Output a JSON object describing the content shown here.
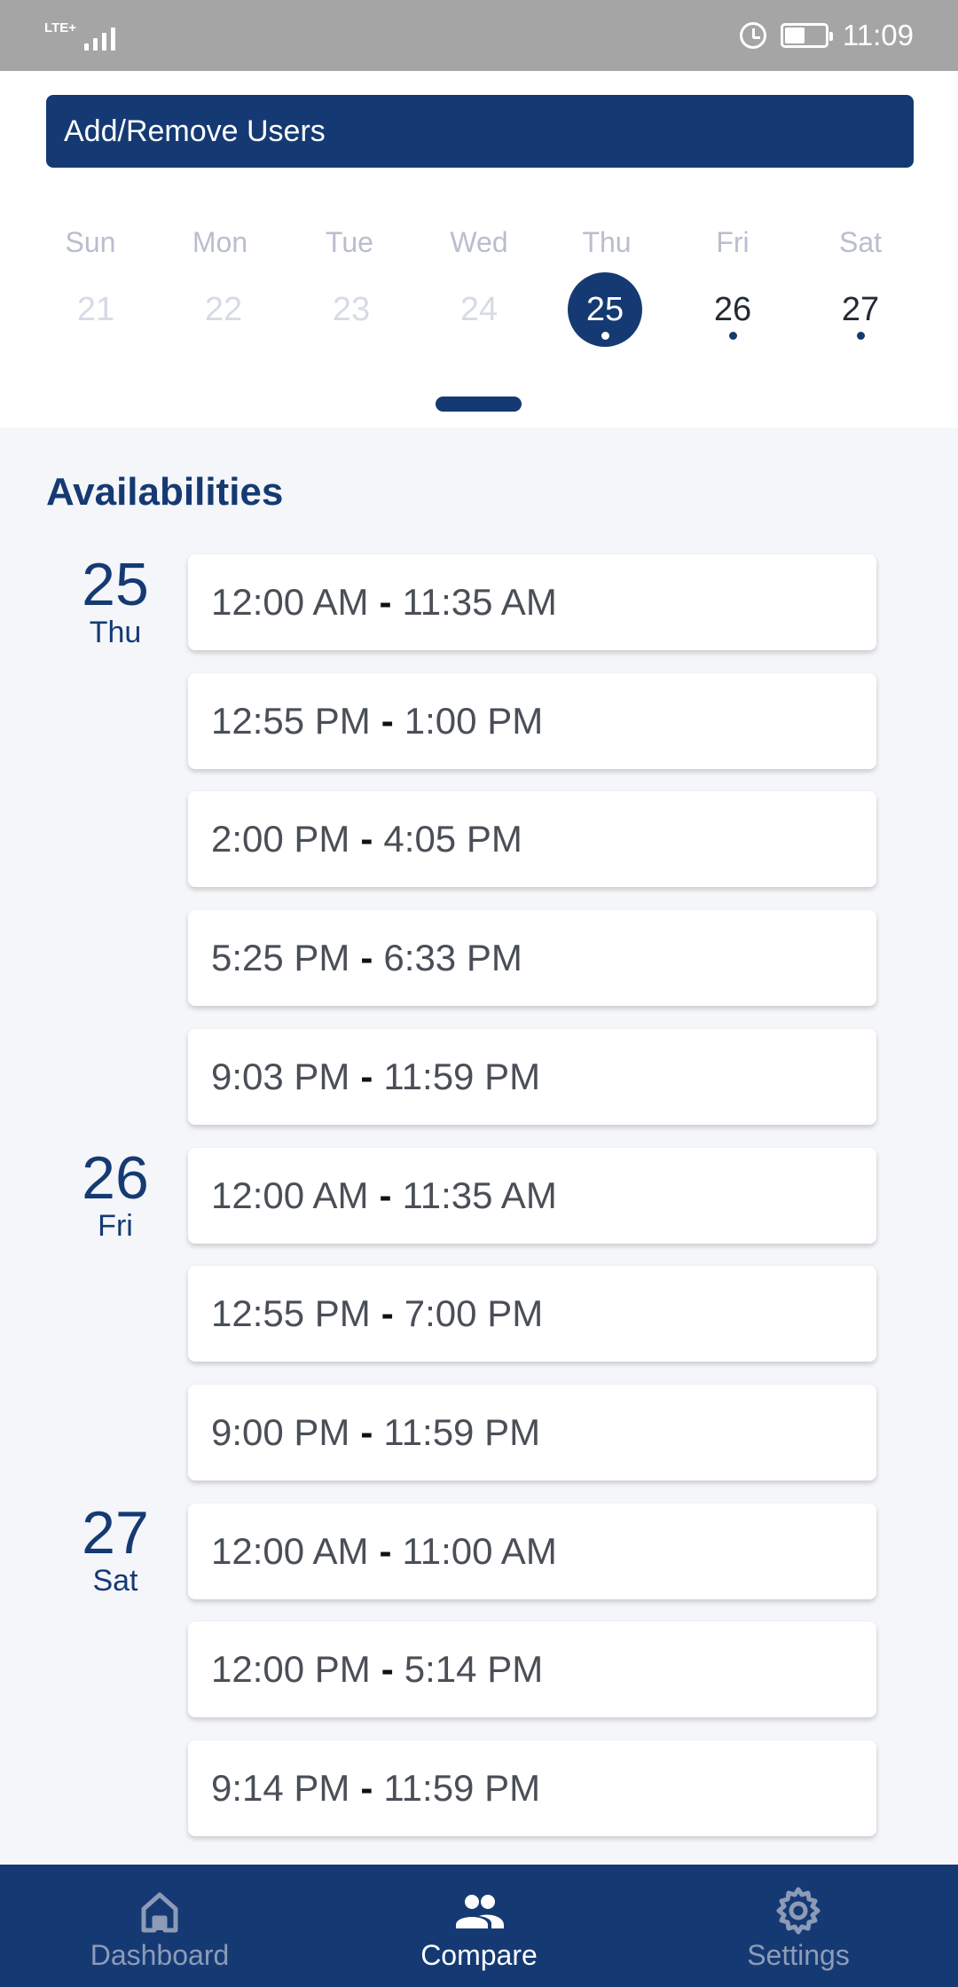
{
  "status_bar": {
    "network": "LTE+",
    "time": "11:09"
  },
  "header": {
    "add_remove_label": "Add/Remove Users"
  },
  "week": {
    "days": [
      {
        "name": "Sun",
        "num": "21",
        "state": "past"
      },
      {
        "name": "Mon",
        "num": "22",
        "state": "past"
      },
      {
        "name": "Tue",
        "num": "23",
        "state": "past"
      },
      {
        "name": "Wed",
        "num": "24",
        "state": "past"
      },
      {
        "name": "Thu",
        "num": "25",
        "state": "selected"
      },
      {
        "name": "Fri",
        "num": "26",
        "state": "upcoming"
      },
      {
        "name": "Sat",
        "num": "27",
        "state": "upcoming"
      }
    ]
  },
  "availabilities": {
    "title": "Availabilities",
    "groups": [
      {
        "day_num": "25",
        "day_name": "Thu",
        "slots": [
          {
            "start": "12:00 AM",
            "end": "11:35 AM"
          },
          {
            "start": "12:55 PM",
            "end": "1:00 PM"
          },
          {
            "start": "2:00 PM",
            "end": "4:05 PM"
          },
          {
            "start": "5:25 PM",
            "end": "6:33 PM"
          },
          {
            "start": "9:03 PM",
            "end": "11:59 PM"
          }
        ]
      },
      {
        "day_num": "26",
        "day_name": "Fri",
        "slots": [
          {
            "start": "12:00 AM",
            "end": "11:35 AM"
          },
          {
            "start": "12:55 PM",
            "end": "7:00 PM"
          },
          {
            "start": "9:00 PM",
            "end": "11:59 PM"
          }
        ]
      },
      {
        "day_num": "27",
        "day_name": "Sat",
        "slots": [
          {
            "start": "12:00 AM",
            "end": "11:00 AM"
          },
          {
            "start": "12:00 PM",
            "end": "5:14 PM"
          },
          {
            "start": "9:14 PM",
            "end": "11:59 PM"
          }
        ]
      }
    ],
    "separator": "-"
  },
  "bottom_nav": {
    "items": [
      {
        "label": "Dashboard",
        "icon": "home-icon",
        "active": false
      },
      {
        "label": "Compare",
        "icon": "people-icon",
        "active": true
      },
      {
        "label": "Settings",
        "icon": "gear-icon",
        "active": false
      }
    ]
  },
  "colors": {
    "primary": "#153a73",
    "background": "#f4f6f9",
    "status_bar": "#a5a5a5"
  }
}
